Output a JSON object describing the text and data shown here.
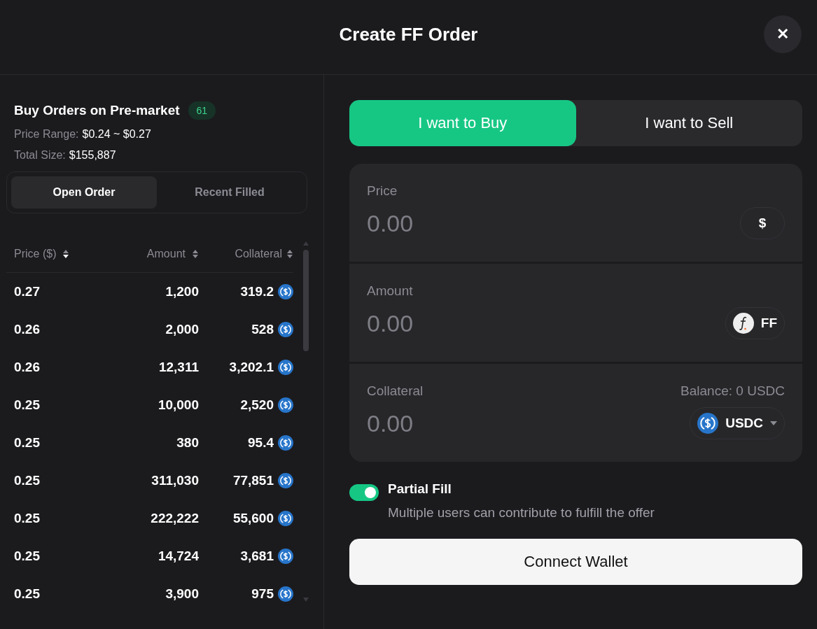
{
  "dialog": {
    "title": "Create FF Order",
    "close_label": "✕"
  },
  "orders": {
    "title": "Buy Orders on Pre-market",
    "count": "61",
    "price_range_label": "Price Range:",
    "price_range": "$0.24 ~ $0.27",
    "total_size_label": "Total Size:",
    "total_size": "$155,887",
    "tabs": [
      {
        "label": "Open Order",
        "selected": true
      },
      {
        "label": "Recent Filled",
        "selected": false
      }
    ],
    "columns": [
      {
        "label": "Price ($)",
        "sorted": true
      },
      {
        "label": "Amount",
        "sorted": false
      },
      {
        "label": "Collateral",
        "sorted": false
      }
    ],
    "rows": [
      {
        "price": "0.27",
        "amount": "1,200",
        "collateral": "319.2"
      },
      {
        "price": "0.26",
        "amount": "2,000",
        "collateral": "528"
      },
      {
        "price": "0.26",
        "amount": "12,311",
        "collateral": "3,202.1"
      },
      {
        "price": "0.25",
        "amount": "10,000",
        "collateral": "2,520"
      },
      {
        "price": "0.25",
        "amount": "380",
        "collateral": "95.4"
      },
      {
        "price": "0.25",
        "amount": "311,030",
        "collateral": "77,851"
      },
      {
        "price": "0.25",
        "amount": "222,222",
        "collateral": "55,600"
      },
      {
        "price": "0.25",
        "amount": "14,724",
        "collateral": "3,681"
      },
      {
        "price": "0.25",
        "amount": "3,900",
        "collateral": "975"
      }
    ]
  },
  "form": {
    "sides": [
      {
        "label": "I want to Buy",
        "selected": true
      },
      {
        "label": "I want to Sell",
        "selected": false
      }
    ],
    "fields": [
      {
        "kind": "currency",
        "label": "Price",
        "placeholder": "0.00",
        "unit": "$"
      },
      {
        "kind": "token",
        "label": "Amount",
        "placeholder": "0.00",
        "unit": "FF"
      },
      {
        "kind": "select",
        "label": "Collateral",
        "placeholder": "0.00",
        "unit": "USDC",
        "balance": "Balance: 0 USDC"
      }
    ],
    "partial_fill": {
      "label": "Partial Fill",
      "on": true,
      "description": "Multiple users can contribute to fulfill the offer"
    },
    "submit": "Connect Wallet"
  }
}
